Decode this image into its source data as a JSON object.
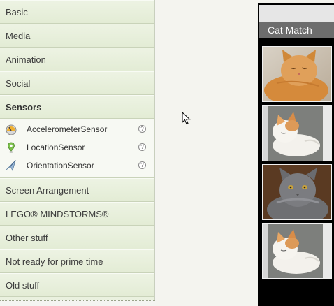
{
  "palette": {
    "drawers": [
      {
        "label": "Basic"
      },
      {
        "label": "Media"
      },
      {
        "label": "Animation"
      },
      {
        "label": "Social"
      },
      {
        "label": "Sensors"
      },
      {
        "label": "Screen Arrangement"
      },
      {
        "label": "LEGO® MINDSTORMS®"
      },
      {
        "label": "Other stuff"
      },
      {
        "label": "Not ready for prime time"
      },
      {
        "label": "Old stuff"
      }
    ],
    "sensor_components": [
      {
        "label": "AccelerometerSensor",
        "icon": "accelerometer-icon",
        "help": "?"
      },
      {
        "label": "LocationSensor",
        "icon": "location-pin-icon",
        "help": "?"
      },
      {
        "label": "OrientationSensor",
        "icon": "orientation-icon",
        "help": "?"
      }
    ]
  },
  "viewer": {
    "app_title": "Cat Match",
    "image_buttons": [
      {
        "image": "orange-cat-sleeping"
      },
      {
        "image": "white-orange-cat-sleeping"
      },
      {
        "image": "grey-longhair-cat"
      },
      {
        "image": "white-orange-cat-sleeping"
      }
    ]
  }
}
